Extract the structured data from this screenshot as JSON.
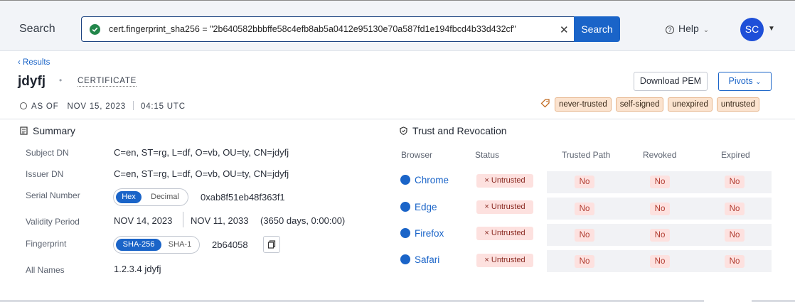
{
  "header": {
    "search_label": "Search",
    "query": "cert.fingerprint_sha256 = \"2b640582bbbffe58c4efb8ab5a0412e95130e70a587fd1e194fbcd4b33d432cf\"",
    "clear_icon": "✕",
    "search_button": "Search",
    "help_label": "Help",
    "avatar_initials": "SC"
  },
  "title_area": {
    "back_link": "‹ Results",
    "title": "jdyfj",
    "kind": "CERTIFICATE",
    "as_of_label": "AS OF",
    "date": "NOV 15, 2023",
    "time": "04:15 UTC",
    "download_button": "Download PEM",
    "pivots_button": "Pivots",
    "tags": [
      "never-trusted",
      "self-signed",
      "unexpired",
      "untrusted"
    ]
  },
  "summary": {
    "title": "Summary",
    "rows": {
      "subject_dn": {
        "label": "Subject DN",
        "value": "C=en, ST=rg, L=df, O=vb, OU=ty, CN=jdyfj"
      },
      "issuer_dn": {
        "label": "Issuer DN",
        "value": "C=en, ST=rg, L=df, O=vb, OU=ty, CN=jdyfj"
      },
      "serial": {
        "label": "Serial Number",
        "toggle_on": "Hex",
        "toggle_off": "Decimal",
        "value": "0xab8f51eb48f363f1"
      },
      "validity": {
        "label": "Validity Period",
        "start": "NOV 14, 2023",
        "end": "NOV 11, 2033",
        "duration": "(3650 days, 0:00:00)"
      },
      "fingerprint": {
        "label": "Fingerprint",
        "toggle_on": "SHA-256",
        "toggle_off": "SHA-1",
        "value": "2b64058"
      },
      "all_names": {
        "label": "All Names",
        "value": "1.2.3.4 jdyfj"
      }
    }
  },
  "trust": {
    "title": "Trust and Revocation",
    "headers": {
      "browser": "Browser",
      "status": "Status",
      "trusted_path": "Trusted Path",
      "revoked": "Revoked",
      "expired": "Expired"
    },
    "rows": [
      {
        "browser": "Chrome",
        "status": "× Untrusted",
        "trusted_path": "No",
        "revoked": "No",
        "expired": "No"
      },
      {
        "browser": "Edge",
        "status": "× Untrusted",
        "trusted_path": "No",
        "revoked": "No",
        "expired": "No"
      },
      {
        "browser": "Firefox",
        "status": "× Untrusted",
        "trusted_path": "No",
        "revoked": "No",
        "expired": "No"
      },
      {
        "browser": "Safari",
        "status": "× Untrusted",
        "trusted_path": "No",
        "revoked": "No",
        "expired": "No"
      }
    ]
  },
  "colors": {
    "accent": "#1a64c8",
    "tag_bg": "#fbe3cf",
    "danger_bg": "#fde1df",
    "ok_green": "#22864a"
  }
}
